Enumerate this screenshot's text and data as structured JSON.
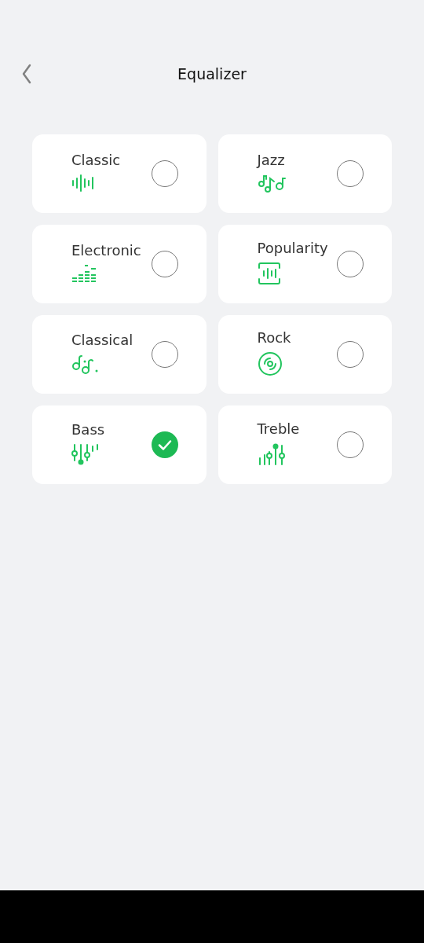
{
  "header": {
    "title": "Equalizer"
  },
  "presets": [
    {
      "label": "Classic",
      "kind": "waveform",
      "selected": false
    },
    {
      "label": "Jazz",
      "kind": "notes",
      "selected": false
    },
    {
      "label": "Electronic",
      "kind": "levels",
      "selected": false
    },
    {
      "label": "Popularity",
      "kind": "voice",
      "selected": false
    },
    {
      "label": "Classical",
      "kind": "score",
      "selected": false
    },
    {
      "label": "Rock",
      "kind": "disc",
      "selected": false
    },
    {
      "label": "Bass",
      "kind": "sliders",
      "selected": true
    },
    {
      "label": "Treble",
      "kind": "bars",
      "selected": false
    }
  ]
}
